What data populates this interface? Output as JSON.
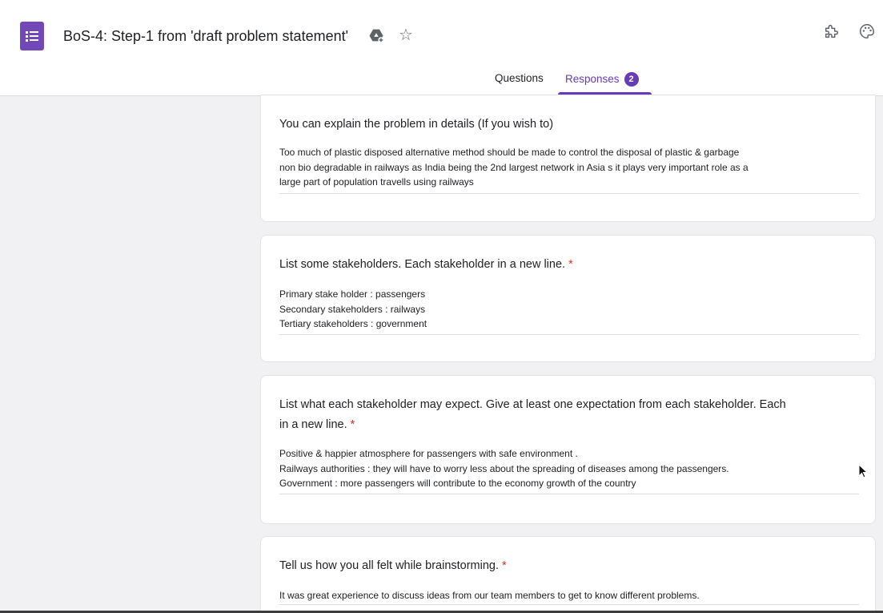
{
  "app": {
    "title": "BoS-4: Step-1 from 'draft problem statement'",
    "accent": "#673ab7",
    "logo_color": "#7248b9"
  },
  "tabs": [
    {
      "label": "Questions",
      "active": false
    },
    {
      "label": "Responses",
      "active": true,
      "badge": "2"
    }
  ],
  "icons": {
    "drive": "move-to-folder-icon",
    "star": "star-icon",
    "addon": "puzzle-icon",
    "palette": "palette-icon"
  },
  "questions": [
    {
      "title": "You can explain the problem in details (If you wish to)",
      "required": false,
      "answer_lines": [
        "Too much of plastic disposed alternative method should be made to control the disposal of plastic & garbage",
        "non bio degradable in railways as India being the 2nd largest network in Asia s it plays very important role as a",
        "large part of population travells using railways"
      ]
    },
    {
      "title": "List some stakeholders. Each stakeholder in a new line.",
      "required": true,
      "answer_lines": [
        "Primary stake holder : passengers",
        "Secondary stakeholders : railways",
        "Tertiary stakeholders : government"
      ]
    },
    {
      "title_lines": [
        "List what each stakeholder may expect. Give at least one expectation from each stakeholder. Each",
        "in a new line."
      ],
      "required": true,
      "answer_lines": [
        "Positive & happier atmosphere for passengers with safe environment .",
        "Railways authorities : they will have to worry less about the spreading of diseases among the passengers.",
        "Government : more passengers will contribute to the economy growth of the country"
      ]
    },
    {
      "title": "Tell us how you all felt while brainstorming.",
      "required": true,
      "answer_lines": [
        "It was great experience to discuss ideas from our team members to get to know different problems."
      ]
    }
  ],
  "required_marker": "*"
}
